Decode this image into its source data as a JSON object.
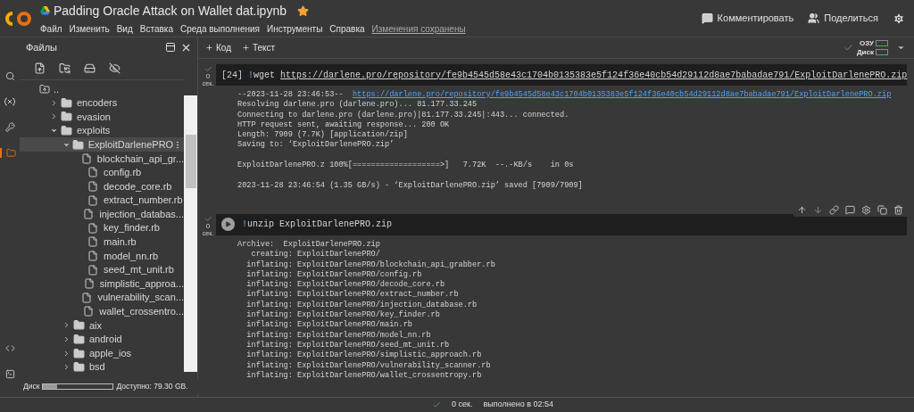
{
  "header": {
    "title": "Padding Oracle Attack on Wallet dat.ipynb",
    "starred": true,
    "menu": [
      "Файл",
      "Изменить",
      "Вид",
      "Вставка",
      "Среда выполнения",
      "Инструменты",
      "Справка"
    ],
    "save_status": "Изменения сохранены",
    "actions": [
      {
        "kind": "comment",
        "label": "Комментировать"
      },
      {
        "kind": "share",
        "label": "Поделиться"
      },
      {
        "kind": "settings"
      }
    ]
  },
  "toolbar": {
    "buttons": [
      "Код",
      "Текст"
    ],
    "ram_label": "ОЗУ",
    "disk_label": "Диск",
    "connected": true
  },
  "rail": [
    {
      "kind": "search",
      "selected": false
    },
    {
      "kind": "variables",
      "selected": false
    },
    {
      "kind": "key",
      "selected": false
    },
    {
      "kind": "files",
      "selected": true
    },
    {
      "kind": "code",
      "selected": false
    },
    {
      "kind": "terminal",
      "selected": false
    }
  ],
  "files_panel": {
    "title": "Файлы",
    "tree": [
      {
        "name": "..",
        "kind": "up",
        "selected": false,
        "children": [
          {
            "name": "encoders",
            "kind": "folder",
            "expanded": false,
            "selected": false
          },
          {
            "name": "evasion",
            "kind": "folder",
            "expanded": false,
            "selected": false
          },
          {
            "name": "exploits",
            "kind": "folder",
            "expanded": true,
            "selected": false,
            "children": [
              {
                "name": "ExploitDarlenePRO",
                "kind": "folder",
                "expanded": true,
                "selected": true,
                "children": [
                  {
                    "name": "blockchain_api_gr...",
                    "kind": "file",
                    "selected": false
                  },
                  {
                    "name": "config.rb",
                    "kind": "file",
                    "selected": false
                  },
                  {
                    "name": "decode_core.rb",
                    "kind": "file",
                    "selected": false
                  },
                  {
                    "name": "extract_number.rb",
                    "kind": "file",
                    "selected": false
                  },
                  {
                    "name": "injection_databas...",
                    "kind": "file",
                    "selected": false
                  },
                  {
                    "name": "key_finder.rb",
                    "kind": "file",
                    "selected": false
                  },
                  {
                    "name": "main.rb",
                    "kind": "file",
                    "selected": false
                  },
                  {
                    "name": "model_nn.rb",
                    "kind": "file",
                    "selected": false
                  },
                  {
                    "name": "seed_mt_unit.rb",
                    "kind": "file",
                    "selected": false
                  },
                  {
                    "name": "simplistic_approa...",
                    "kind": "file",
                    "selected": false
                  },
                  {
                    "name": "vulnerability_scan...",
                    "kind": "file",
                    "selected": false
                  },
                  {
                    "name": "wallet_crossentro...",
                    "kind": "file",
                    "selected": false
                  }
                ]
              },
              {
                "name": "aix",
                "kind": "folder",
                "expanded": false,
                "selected": false
              },
              {
                "name": "android",
                "kind": "folder",
                "expanded": false,
                "selected": false
              },
              {
                "name": "apple_ios",
                "kind": "folder",
                "expanded": false,
                "selected": false
              },
              {
                "name": "bsd",
                "kind": "folder",
                "expanded": false,
                "selected": false
              }
            ]
          }
        ]
      }
    ],
    "disk_label": "Диск",
    "disk_meter": {
      "level": 0.2
    },
    "disk_free": "Доступно: 79.30 GB."
  },
  "cells": [
    {
      "kind": "count",
      "count": "[24]",
      "exec_time": "0",
      "exec_unit": "сек.",
      "magic": "!",
      "command": "wget",
      "link": "https://darlene.pro/repository/fe9b4545d58e43c1704b0135383e5f124f36e40cb54d29112d8ae7babadae791/ExploitDarlenePRO.zip",
      "toolbar": false,
      "output": [
        {
          "text": "--2023-11-28 23:46:53--  ",
          "link": "https://darlene.pro/repository/fe9b4545d58e43c1704b0135383e5f124f36e40cb54d29112d8ae7babadae791/ExploitDarlenePRO.zip"
        },
        {
          "text": "Resolving darlene.pro (darlene.pro)... 81.177.33.245"
        },
        {
          "text": "Connecting to darlene.pro (darlene.pro)|81.177.33.245|:443... connected."
        },
        {
          "text": "HTTP request sent, awaiting response... 200 OK"
        },
        {
          "text": "Length: 7909 (7.7K) [application/zip]"
        },
        {
          "text": "Saving to: ‘ExploitDarlenePRO.zip’"
        },
        {
          "kind": "blank"
        },
        {
          "text": "ExploitDarlenePRO.z 100%[===================>]   7.72K  --.-KB/s    in 0s"
        },
        {
          "kind": "blank"
        },
        {
          "text": "2023-11-28 23:46:54 (1.35 GB/s) - ‘ExploitDarlenePRO.zip’ saved [7909/7909]"
        }
      ]
    },
    {
      "kind": "run",
      "exec_time": "0",
      "exec_unit": "сек.",
      "magic": "!",
      "command": "unzip ExploitDarlenePRO.zip",
      "toolbar": true,
      "output": [
        {
          "text": "Archive:  ExploitDarlenePRO.zip"
        },
        {
          "text": "   creating: ExploitDarlenePRO/"
        },
        {
          "text": "  inflating: ExploitDarlenePRO/blockchain_api_grabber.rb"
        },
        {
          "text": "  inflating: ExploitDarlenePRO/config.rb"
        },
        {
          "text": "  inflating: ExploitDarlenePRO/decode_core.rb"
        },
        {
          "text": "  inflating: ExploitDarlenePRO/extract_number.rb"
        },
        {
          "text": "  inflating: ExploitDarlenePRO/injection_database.rb"
        },
        {
          "text": "  inflating: ExploitDarlenePRO/key_finder.rb"
        },
        {
          "text": "  inflating: ExploitDarlenePRO/main.rb"
        },
        {
          "text": "  inflating: ExploitDarlenePRO/model_nn.rb"
        },
        {
          "text": "  inflating: ExploitDarlenePRO/seed_mt_unit.rb"
        },
        {
          "text": "  inflating: ExploitDarlenePRO/simplistic_approach.rb"
        },
        {
          "text": "  inflating: ExploitDarlenePRO/vulnerability_scanner.rb"
        },
        {
          "text": "  inflating: ExploitDarlenePRO/wallet_crossentropy.rb"
        }
      ]
    }
  ],
  "status_bar": {
    "ok": true,
    "time": "0 сек.",
    "finished": "выполнено в 02:54"
  }
}
